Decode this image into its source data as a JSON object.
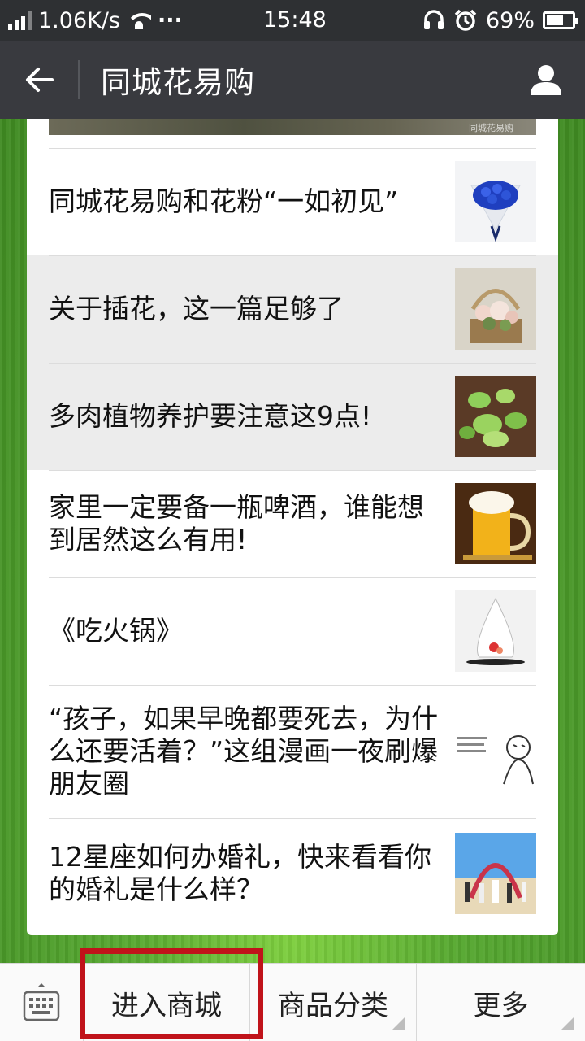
{
  "status": {
    "speed": "1.06K/s",
    "dots": "···",
    "time": "15:48",
    "battery": "69%",
    "battery_level": 0.69
  },
  "header": {
    "title": "同城花易购"
  },
  "banner": {
    "watermark": "同城花易购"
  },
  "articles": [
    {
      "title": "同城花易购和花粉“一如初见”",
      "thumb": "blue-rose-bouquet",
      "highlighted": false
    },
    {
      "title": "关于插花，这一篇足够了",
      "thumb": "flower-basket",
      "highlighted": true
    },
    {
      "title": "多肉植物养护要注意这9点!",
      "thumb": "succulents",
      "highlighted": true
    },
    {
      "title": "家里一定要备一瓶啤酒，谁能想到居然这么有用!",
      "thumb": "beer-mug",
      "highlighted": false
    },
    {
      "title": "《吃火锅》",
      "thumb": "glass-dessert",
      "highlighted": false
    },
    {
      "title": "“孩子，如果早晚都要死去，为什么还要活着？”这组漫画一夜刷爆朋友圈",
      "thumb": "comic-sketch",
      "highlighted": false
    },
    {
      "title": "12星座如何办婚礼，快来看看你的婚礼是什么样？",
      "thumb": "beach-wedding",
      "highlighted": false
    }
  ],
  "menu": {
    "enter_mall": "进入商城",
    "categories": "商品分类",
    "more": "更多"
  },
  "colors": {
    "header_bg": "#393a3f",
    "status_bg": "#2e3033",
    "highlight": "#c0131a"
  }
}
